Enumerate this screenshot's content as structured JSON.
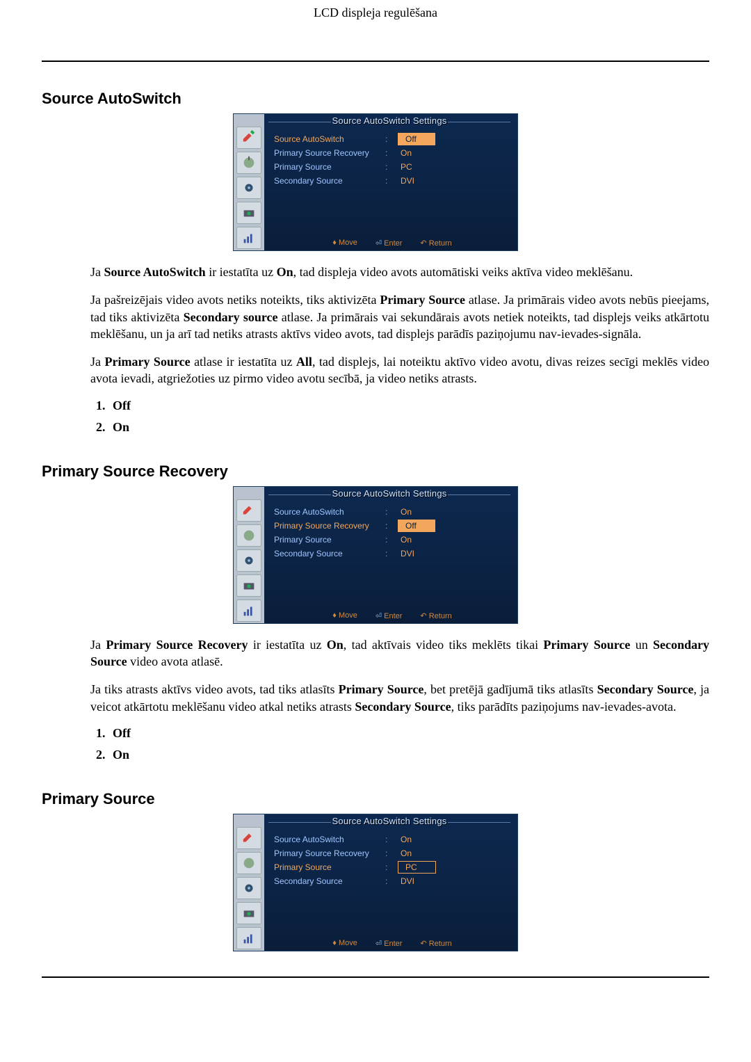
{
  "header": {
    "title": "LCD displeja regulēšana"
  },
  "sections": {
    "s1": {
      "title": "Source AutoSwitch",
      "para1_pre": "Ja ",
      "para1_b1": "Source AutoSwitch",
      "para1_mid1": " ir iestatīta uz ",
      "para1_b2": "On",
      "para1_post": ", tad displeja video avots automātiski veiks aktīva video meklēšanu.",
      "para2_a": "Ja pašreizējais video avots netiks noteikts, tiks aktivizēta ",
      "para2_b1": "Primary Source",
      "para2_b": " atlase. Ja primārais video avots nebūs pieejams, tad tiks aktivizēta ",
      "para2_b2": "Secondary source",
      "para2_c": " atlase. Ja primārais vai sekundārais avots netiek noteikts, tad displejs veiks atkārtotu meklēšanu, un ja arī tad netiks atrasts aktīvs video avots, tad displejs parādīs paziņojumu nav-ievades-signāla.",
      "para3_a": "Ja ",
      "para3_b1": "Primary Source",
      "para3_b": " atlase ir iestatīta uz ",
      "para3_b2": "All",
      "para3_c": ", tad displejs, lai noteiktu aktīvo video avotu, divas reizes secīgi meklēs video avota ievadi, atgriežoties uz pirmo video avotu secībā, ja video netiks atrasts.",
      "opts": {
        "o1": "Off",
        "o2": "On"
      }
    },
    "s2": {
      "title": "Primary Source Recovery",
      "para1_pre": "Ja ",
      "para1_b1": "Primary Source Recovery",
      "para1_mid1": " ir iestatīta uz ",
      "para1_b2": "On",
      "para1_mid2": ", tad aktīvais video tiks meklēts tikai ",
      "para1_b3": "Primary Source",
      "para1_mid3": " un ",
      "para1_b4": "Secondary Source",
      "para1_post": " video avota atlasē.",
      "para2_a": "Ja tiks atrasts aktīvs video avots, tad tiks atlasīts ",
      "para2_b1": "Primary Source",
      "para2_b": ", bet pretējā gadījumā tiks atlasīts ",
      "para2_b2": "Secondary Source",
      "para2_c": ", ja veicot atkārtotu meklēšanu video atkal netiks atrasts ",
      "para2_b3": "Secondary Source",
      "para2_d": ", tiks parādīts paziņojums nav-ievades-avota.",
      "opts": {
        "o1": "Off",
        "o2": "On"
      }
    },
    "s3": {
      "title": "Primary Source"
    }
  },
  "osd_common": {
    "title": "Source AutoSwitch Settings",
    "labels": {
      "l1": "Source AutoSwitch",
      "l2": "Primary Source Recovery",
      "l3": "Primary Source",
      "l4": "Secondary Source"
    },
    "hints": {
      "move": "Move",
      "enter": "Enter",
      "return": "Return"
    }
  },
  "osd1": {
    "v1": "Off",
    "v2": "On",
    "v3": "PC",
    "v4": "DVI",
    "highlight_row": 1,
    "boxed_row": 1
  },
  "osd2": {
    "v1": "On",
    "v2": "Off",
    "v3": "On",
    "v4": "DVI",
    "highlight_row": 2,
    "boxed_row": 2
  },
  "osd3": {
    "v1": "On",
    "v2": "On",
    "v3": "PC",
    "v4": "DVI",
    "highlight_row": 3,
    "boxed_row": 3
  }
}
